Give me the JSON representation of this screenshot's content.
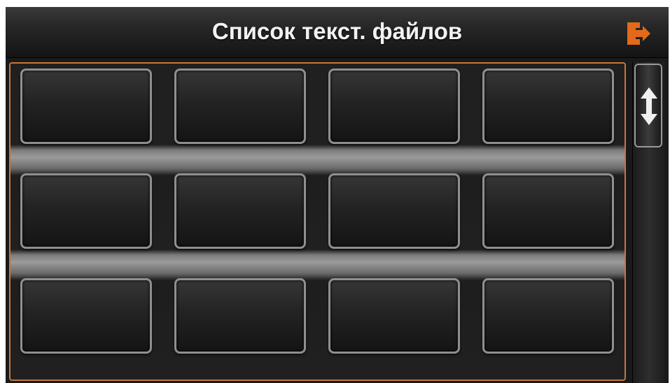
{
  "header": {
    "title": "Список текст. файлов",
    "exit_icon": "exit-door-arrow-icon",
    "accent_color": "#e36a1a"
  },
  "file_grid": {
    "rows": 3,
    "columns": 4,
    "tiles": [
      {
        "label": ""
      },
      {
        "label": ""
      },
      {
        "label": ""
      },
      {
        "label": ""
      },
      {
        "label": ""
      },
      {
        "label": ""
      },
      {
        "label": ""
      },
      {
        "label": ""
      },
      {
        "label": ""
      },
      {
        "label": ""
      },
      {
        "label": ""
      },
      {
        "label": ""
      }
    ],
    "border_color": "#c8763a"
  },
  "scrollbar": {
    "thumb_icon": "up-down-arrow-icon"
  }
}
